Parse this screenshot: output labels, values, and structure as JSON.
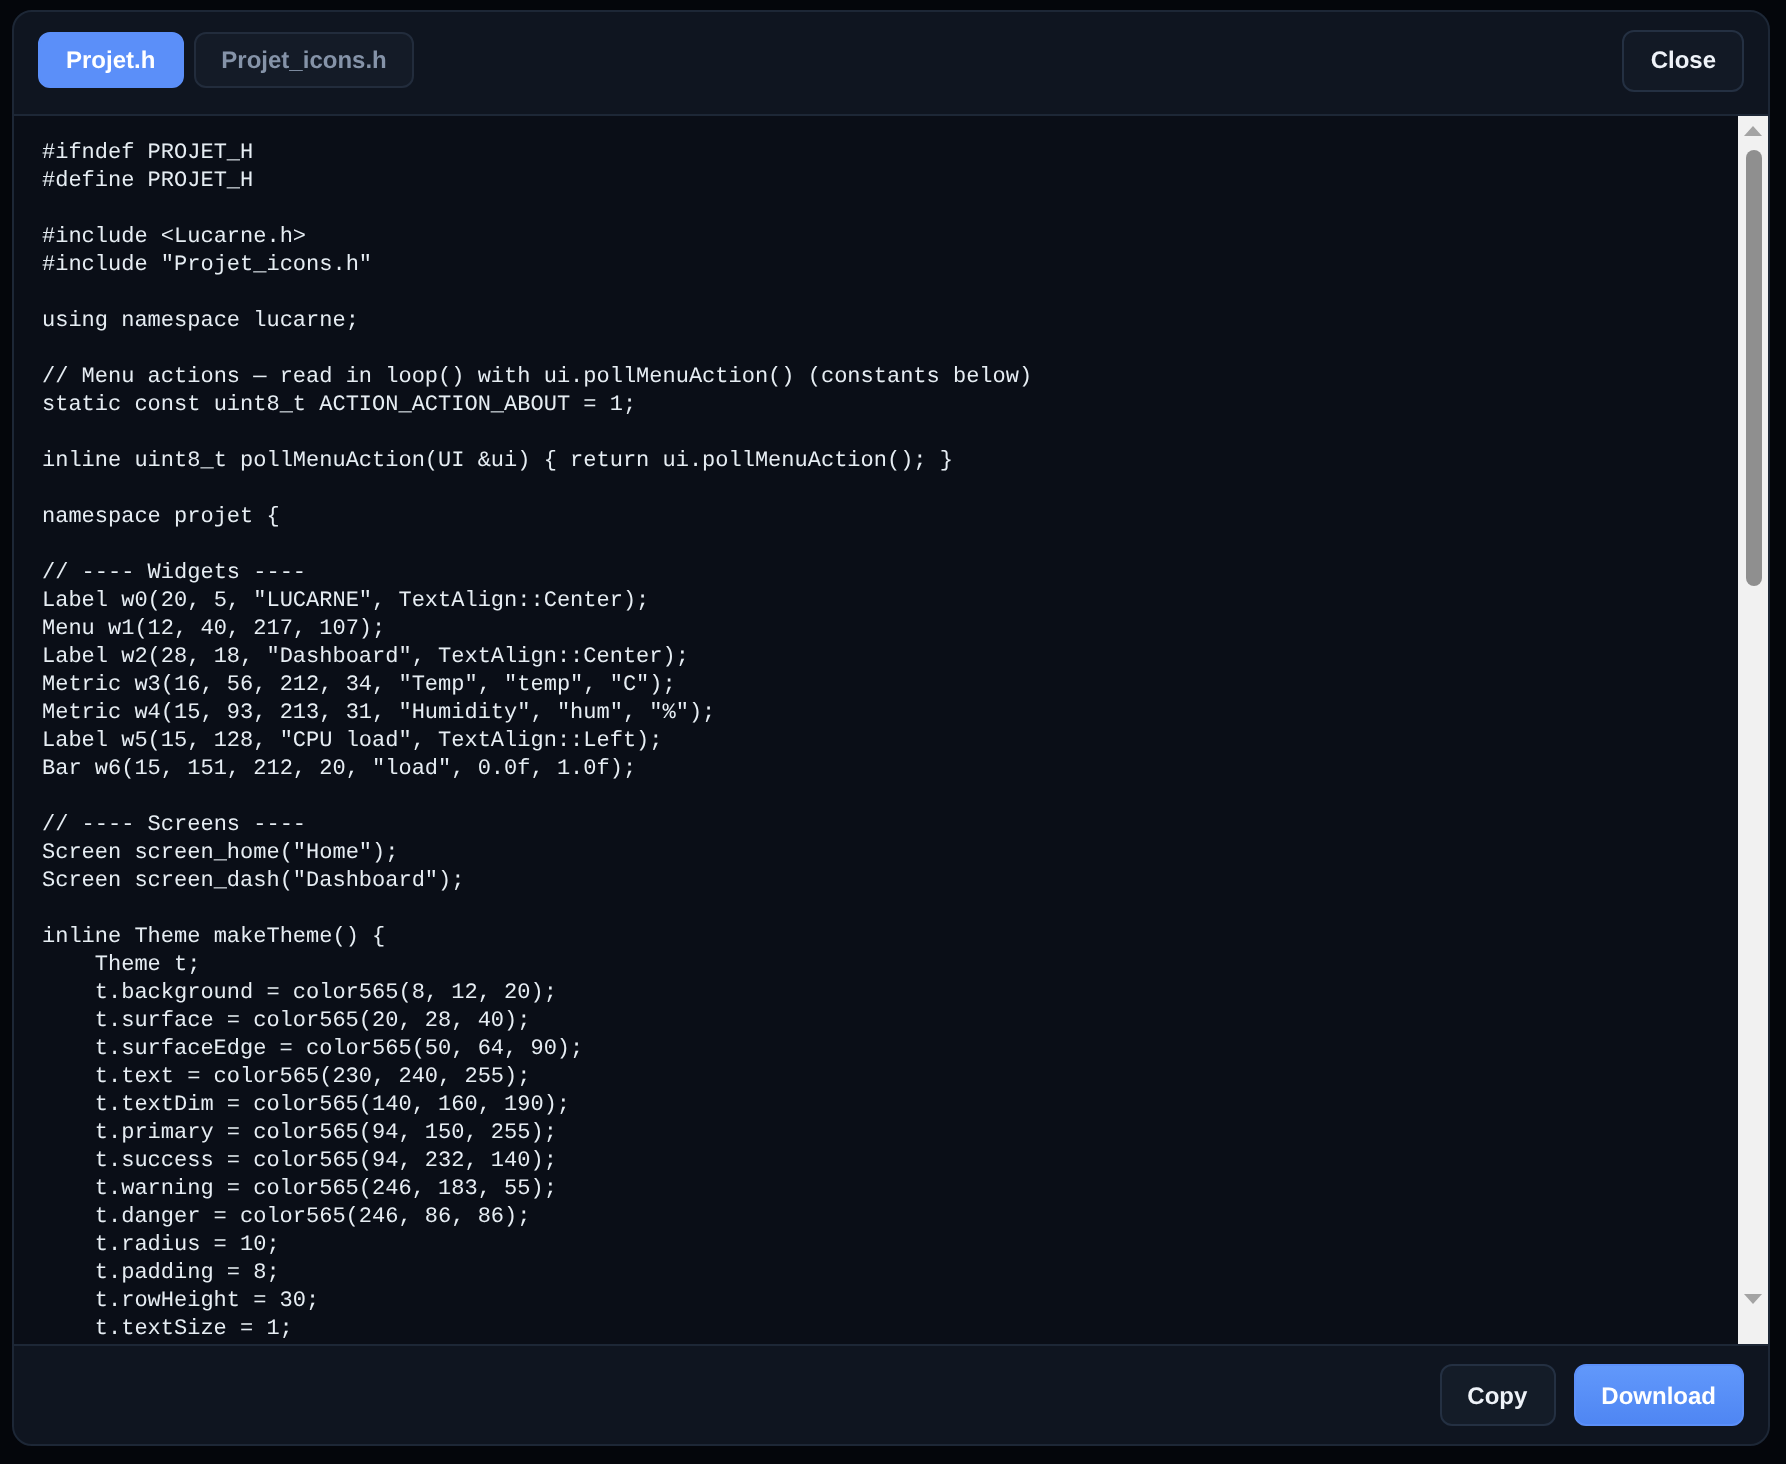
{
  "tabs": [
    {
      "label": "Projet.h",
      "selected": true
    },
    {
      "label": "Projet_icons.h",
      "selected": false
    }
  ],
  "close_button": "Close",
  "code_blocks": [
    {
      "lines": [
        "#ifndef PROJET_H",
        "#define PROJET_H"
      ]
    },
    {
      "lines": [
        "#include <Lucarne.h>",
        "#include \"Projet_icons.h\""
      ]
    },
    {
      "lines": [
        "using namespace lucarne;"
      ]
    },
    {
      "lines": [
        "// Menu actions — read in loop() with ui.pollMenuAction() (constants below)",
        "static const uint8_t ACTION_ACTION_ABOUT = 1;"
      ]
    },
    {
      "lines": [
        "inline uint8_t pollMenuAction(UI &ui) { return ui.pollMenuAction(); }"
      ]
    },
    {
      "lines": [
        "namespace projet {"
      ]
    },
    {
      "lines": [
        "// ---- Widgets ----",
        "Label w0(20, 5, \"LUCARNE\", TextAlign::Center);",
        "Menu w1(12, 40, 217, 107);",
        "Label w2(28, 18, \"Dashboard\", TextAlign::Center);",
        "Metric w3(16, 56, 212, 34, \"Temp\", \"temp\", \"C\");",
        "Metric w4(15, 93, 213, 31, \"Humidity\", \"hum\", \"%\");",
        "Label w5(15, 128, \"CPU load\", TextAlign::Left);",
        "Bar w6(15, 151, 212, 20, \"load\", 0.0f, 1.0f);"
      ]
    },
    {
      "lines": [
        "// ---- Screens ----",
        "Screen screen_home(\"Home\");",
        "Screen screen_dash(\"Dashboard\");"
      ]
    },
    {
      "lines": [
        "inline Theme makeTheme() {"
      ],
      "children": [
        {
          "lines": [
            "Theme t;",
            "t.background = color565(8, 12, 20);",
            "t.surface = color565(20, 28, 40);",
            "t.surfaceEdge = color565(50, 64, 90);",
            "t.text = color565(230, 240, 255);",
            "t.textDim = color565(140, 160, 190);",
            "t.primary = color565(94, 150, 255);",
            "t.success = color565(94, 232, 140);",
            "t.warning = color565(246, 183, 55);",
            "t.danger = color565(246, 86, 86);",
            "t.radius = 10;",
            "t.padding = 8;",
            "t.rowHeight = 30;",
            "t.textSize = 1;"
          ]
        }
      ]
    }
  ],
  "footer_buttons": [
    {
      "label": "Copy",
      "kind": "secondary"
    },
    {
      "label": "Download",
      "kind": "primary"
    }
  ]
}
